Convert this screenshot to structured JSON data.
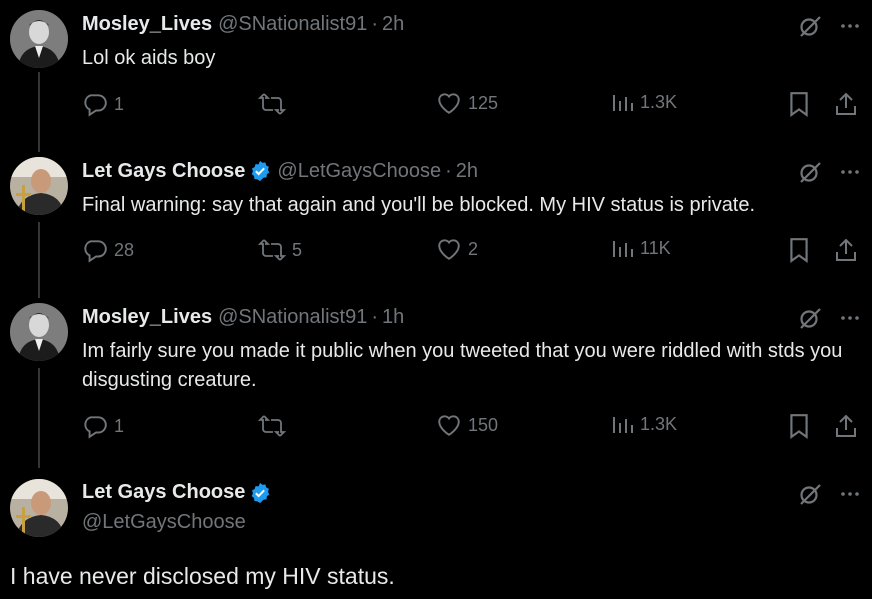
{
  "tweets": [
    {
      "name": "Mosley_Lives",
      "handle": "@SNationalist91",
      "time": "2h",
      "text": "Lol ok aids boy",
      "replies": "1",
      "retweets": "",
      "likes": "125",
      "views": "1.3K",
      "verified": false
    },
    {
      "name": "Let Gays Choose",
      "handle": "@LetGaysChoose",
      "time": "2h",
      "text": "Final warning: say that again and you'll be blocked. My HIV status is private.",
      "replies": "28",
      "retweets": "5",
      "likes": "2",
      "views": "11K",
      "verified": true
    },
    {
      "name": "Mosley_Lives",
      "handle": "@SNationalist91",
      "time": "1h",
      "text": "Im fairly sure you made it public when you tweeted that you were riddled with stds you disgusting creature.",
      "replies": "1",
      "retweets": "",
      "likes": "150",
      "views": "1.3K",
      "verified": false
    }
  ],
  "focus": {
    "name": "Let Gays Choose",
    "handle": "@LetGaysChoose",
    "text": "I have never disclosed my HIV status."
  },
  "colors": {
    "background": "#000000",
    "text": "#e7e9ea",
    "muted": "#71767b",
    "verified": "#1d9bf0",
    "thread_line": "#333639"
  },
  "separator": "·"
}
